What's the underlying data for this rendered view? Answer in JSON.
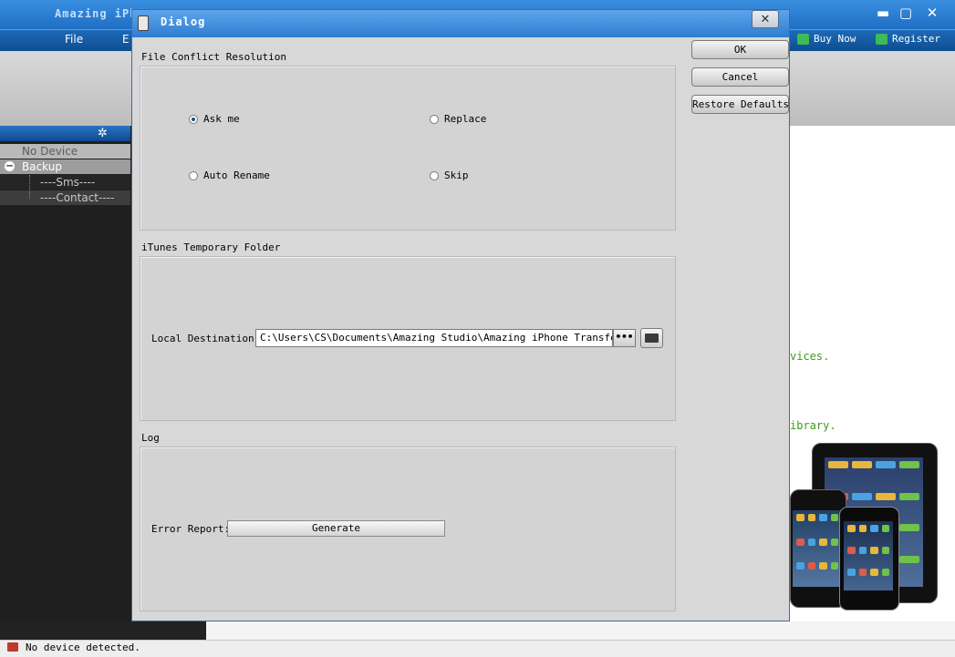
{
  "main_window": {
    "title": "Amazing iPh",
    "controls": {
      "minimize": "▬",
      "maximize": "▢",
      "close": "✕"
    },
    "menu": {
      "file": "File",
      "edit": "E"
    },
    "toolbar": {
      "buy_now": "Buy Now",
      "register": "Register"
    },
    "sidebar": {
      "header_icon": "gear-icon",
      "no_device": "No Device",
      "backup": "Backup",
      "sms": "----Sms----",
      "contact": "----Contact----"
    },
    "content_fragments": {
      "line1": "vices.",
      "line2": "ibrary."
    },
    "status": {
      "text": "No device detected."
    }
  },
  "dialog": {
    "title": "Dialog",
    "close_symbol": "✕",
    "buttons": {
      "ok": "OK",
      "cancel": "Cancel",
      "restore_defaults": "Restore Defaults"
    },
    "file_conflict": {
      "label": "File Conflict Resolution",
      "options": [
        {
          "label": "Ask me",
          "selected": true
        },
        {
          "label": "Replace",
          "selected": false
        },
        {
          "label": "Auto Rename",
          "selected": false
        },
        {
          "label": "Skip",
          "selected": false
        }
      ]
    },
    "itunes_folder": {
      "label": "iTunes Temporary Folder",
      "destination_label": "Local Destination:",
      "destination_value": "C:\\Users\\CS\\Documents\\Amazing Studio\\Amazing iPhone Transfer\\iTu",
      "browse_label": "•••"
    },
    "log": {
      "label": "Log",
      "error_report_label": "Error Report:",
      "generate_label": "Generate"
    }
  }
}
